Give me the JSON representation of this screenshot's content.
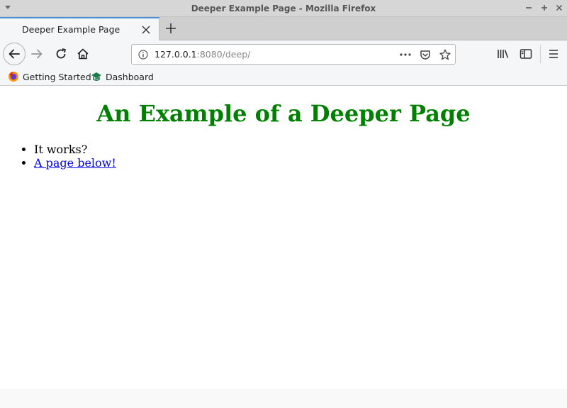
{
  "window": {
    "title": "Deeper Example Page - Mozilla Firefox"
  },
  "tabs": [
    {
      "label": "Deeper Example Page",
      "active": true
    }
  ],
  "url": {
    "host": "127.0.0.1",
    "rest": ":8080/deep/"
  },
  "bookmarks": [
    {
      "label": "Getting Started",
      "icon": "firefox-icon"
    },
    {
      "label": "Dashboard",
      "icon": "dashboard-icon"
    }
  ],
  "page": {
    "heading": "An Example of a Deeper Page",
    "items": [
      {
        "text": "It works?"
      },
      {
        "text": "A page below!",
        "link": true
      }
    ]
  },
  "colors": {
    "heading": "#008000",
    "link": "#0000ee",
    "tab_accent": "#4a90d9"
  }
}
